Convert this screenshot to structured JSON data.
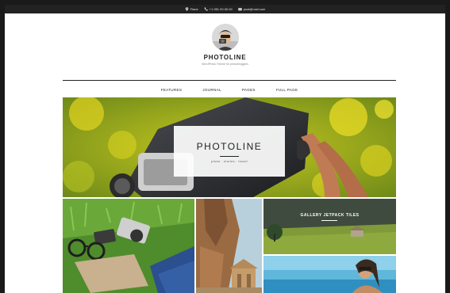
{
  "topbar": {
    "location": "Flane",
    "phone": "+1 951 00.00.00",
    "email": "post@mail.com"
  },
  "brand": {
    "title": "PHOTOLINE",
    "tagline": "WordPress Theme for photobloggers"
  },
  "nav": {
    "items": [
      {
        "label": "FEATURES"
      },
      {
        "label": "JOURNAL"
      },
      {
        "label": "PAGES"
      },
      {
        "label": "FULL PAGE"
      }
    ]
  },
  "hero": {
    "title": "PHOTOLINE",
    "subtitle": "photo · stories · travel"
  },
  "gallery": {
    "tile_label": "GALLERY JETPACK TILES"
  },
  "colors": {
    "topbar": "#222222",
    "text_dark": "#222222",
    "hero_green": "#8da51c",
    "hero_yellow": "#e3d420"
  },
  "icons": {
    "location": "map-pin-icon",
    "phone": "phone-icon",
    "email": "envelope-icon"
  }
}
